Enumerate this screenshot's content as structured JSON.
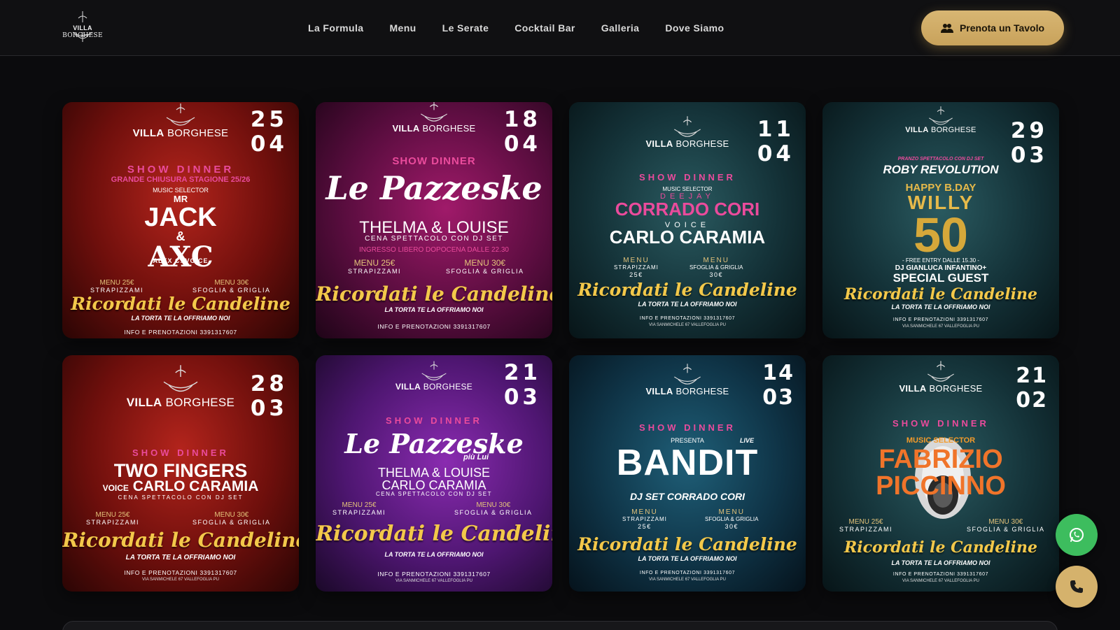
{
  "header": {
    "logo": {
      "brand_bold": "VILLA",
      "brand_rest": "BORGHESE"
    },
    "nav": [
      "La Formula",
      "Menu",
      "Le Serate",
      "Cocktail Bar",
      "Galleria",
      "Dove Siamo"
    ],
    "cta_label": "Prenota un Tavolo"
  },
  "cards": [
    {
      "day": "25",
      "month": "04",
      "brand_bold": "VILLA",
      "brand_rest": "BORGHESE",
      "event": "SHOW DINNER",
      "subtitle": "GRANDE CHIUSURA STAGIONE 25/26",
      "selector": "MUSIC SELECTOR",
      "mr": "MR",
      "artist1": "JACK",
      "amp": "&",
      "artist2": "AXC",
      "artist2_sub": "ALEX C. VOICE",
      "menu_left_price": "MENU 25€",
      "menu_left_name": "STRAPIZZAMI",
      "menu_right_price": "MENU 30€",
      "menu_right_name": "SFOGLIA & GRIGLIA",
      "script": "Ricordati le Candeline",
      "tagline": "LA TORTA TE LA OFFRIAMO NOI",
      "info": "INFO E PRENOTAZIONI  3391317607"
    },
    {
      "day": "18",
      "month": "04",
      "brand_bold": "VILLA",
      "brand_rest": "BORGHESE",
      "event": "SHOW DINNER",
      "title": "Le Pazzeske",
      "artist": "THELMA & LOUISE",
      "cena": "CENA SPETTACOLO CON DJ SET",
      "ingresso": "INGRESSO LIBERO DOPOCENA DALLE 22.30",
      "menu_left_price": "MENU 25€",
      "menu_left_name": "STRAPIZZAMI",
      "menu_right_price": "MENU 30€",
      "menu_right_name": "SFOGLIA & GRIGLIA",
      "script": "Ricordati le Candeline",
      "tagline": "LA TORTA TE LA OFFRIAMO NOI",
      "info": "INFO E PRENOTAZIONI  3391317607"
    },
    {
      "day": "11",
      "month": "04",
      "brand_bold": "VILLA",
      "brand_rest": "BORGHESE",
      "event": "SHOW DINNER",
      "selector": "MUSIC SELECTOR",
      "deejay": "DEEJAY",
      "artist1": "CORRADO CORI",
      "voice": "VOICE",
      "artist2": "CARLO CARAMIA",
      "menu_left_price": "MENU",
      "menu_left_name": "STRAPIZZAMI",
      "menu_left_val": "25€",
      "menu_right_price": "MENU",
      "menu_right_name": "SFOGLIA & GRIGLIA",
      "menu_right_val": "30€",
      "script": "Ricordati le Candeline",
      "tagline": "LA TORTA TE LA OFFRIAMO NOI",
      "info": "INFO E PRENOTAZIONI  3391317607",
      "addr": "VIA SANMICHELE 67 VALLEFOGLIA PU"
    },
    {
      "day": "29",
      "month": "03",
      "brand_bold": "VILLA",
      "brand_rest": "BORGHESE",
      "pranzo": "PRANZO SPETTACOLO CON DJ SET",
      "artist": "ROBY REVOLUTION",
      "happy": "HAPPY B.DAY",
      "name": "WILLY",
      "num": "50",
      "free": "- FREE ENTRY DALLE 15.30 -",
      "dj": "DJ GIANLUCA INFANTINO+",
      "guest": "SPECIAL GUEST",
      "script": "Ricordati le Candeline",
      "tagline": "LA TORTA TE LA OFFRIAMO NOI",
      "info": "INFO E PRENOTAZIONI  3391317607",
      "addr": "VIA SANMICHELE 67 VALLEFOGLIA PU"
    },
    {
      "day": "28",
      "month": "03",
      "brand_bold": "VILLA",
      "brand_rest": "BORGHESE",
      "event": "SHOW DINNER",
      "artist1": "TWO FINGERS",
      "voice": "VOICE",
      "artist2": "CARLO CARAMIA",
      "cena": "CENA SPETTACOLO CON DJ SET",
      "menu_left_price": "MENU 25€",
      "menu_left_name": "STRAPIZZAMI",
      "menu_right_price": "MENU 30€",
      "menu_right_name": "SFOGLIA & GRIGLIA",
      "script": "Ricordati le Candeline",
      "tagline": "LA TORTA TE LA OFFRIAMO NOI",
      "info": "INFO E PRENOTAZIONI  3391317607",
      "addr": "VIA SANMICHELE 67 VALLEFOGLIA PU"
    },
    {
      "day": "21",
      "month": "03",
      "brand_bold": "VILLA",
      "brand_rest": "BORGHESE",
      "event": "SHOW DINNER",
      "title": "Le Pazzeske",
      "title_sub": "più Lui",
      "artist1": "THELMA & LOUISE",
      "artist2": "CARLO CARAMIA",
      "cena": "CENA SPETTACOLO CON DJ SET",
      "menu_left_price": "MENU 25€",
      "menu_left_name": "STRAPIZZAMI",
      "menu_right_price": "MENU 30€",
      "menu_right_name": "SFOGLIA & GRIGLIA",
      "script": "Ricordati le Candeline",
      "tagline": "LA TORTA TE LA OFFRIAMO NOI",
      "info": "INFO E PRENOTAZIONI  3391317607",
      "addr": "VIA SANMICHELE 67 VALLEFOGLIA PU"
    },
    {
      "day": "14",
      "month": "03",
      "brand_bold": "VILLA",
      "brand_rest": "BORGHESE",
      "event": "SHOW DINNER",
      "presenta": "PRESENTA",
      "live": "LIVE",
      "artist": "BANDIT",
      "dj": "DJ SET CORRADO CORI",
      "menu_left_price": "MENU",
      "menu_left_name": "STRAPIZZAMI",
      "menu_left_val": "25€",
      "menu_right_price": "MENU",
      "menu_right_name": "SFOGLIA & GRIGLIA",
      "menu_right_val": "30€",
      "script": "Ricordati le Candeline",
      "tagline": "LA TORTA TE LA OFFRIAMO NOI",
      "info": "INFO E PRENOTAZIONI  3391317607",
      "addr": "VIA SANMICHELE 67 VALLEFOGLIA PU"
    },
    {
      "day": "21",
      "month": "02",
      "brand_bold": "VILLA",
      "brand_rest": "BORGHESE",
      "event": "SHOW DINNER",
      "selector": "MUSIC SELECTOR",
      "artist1": "FABRIZIO",
      "artist2": "PICCINNO",
      "menu_left_price": "MENU 25€",
      "menu_left_name": "STRAPIZZAMI",
      "menu_right_price": "MENU 30€",
      "menu_right_name": "SFOGLIA & GRIGLIA",
      "script": "Ricordati le Candeline",
      "tagline": "LA TORTA TE LA OFFRIAMO NOI",
      "info": "INFO E PRENOTAZIONI  3391317607",
      "addr": "VIA SANMICHELE 67 VALLEFOGLIA PU"
    }
  ],
  "colors": {
    "accent_gold": "#d5b26c",
    "whatsapp_green": "#3dbd5e",
    "show_pink": "#ea4b9c",
    "script_yellow": "#f3c84a"
  },
  "icons": {
    "cta": "people-icon",
    "whatsapp": "whatsapp-icon",
    "call": "phone-icon",
    "chandelier": "chandelier-icon"
  }
}
